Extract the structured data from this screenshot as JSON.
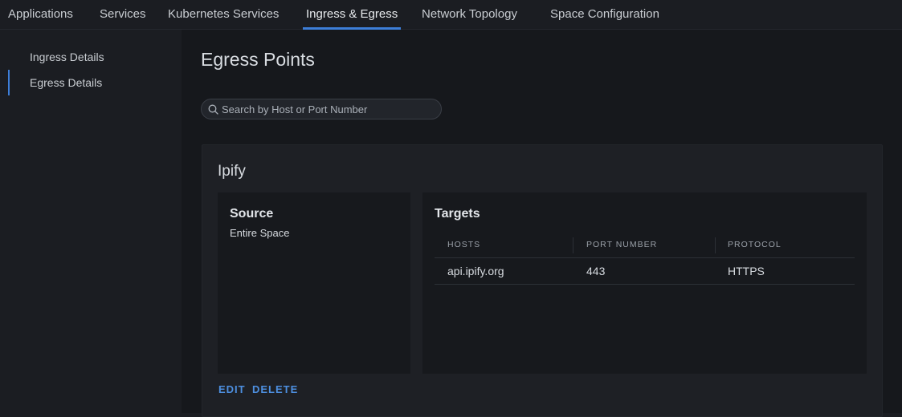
{
  "topnav": {
    "tabs": [
      {
        "label": "Applications"
      },
      {
        "label": "Services"
      },
      {
        "label": "Kubernetes Services"
      },
      {
        "label": "Ingress & Egress",
        "active": true
      },
      {
        "label": "Network Topology"
      },
      {
        "label": "Space Configuration"
      }
    ]
  },
  "sidebar": {
    "items": [
      {
        "label": "Ingress Details"
      },
      {
        "label": "Egress Details",
        "active": true
      }
    ]
  },
  "main": {
    "title": "Egress Points",
    "search": {
      "placeholder": "Search by Host or Port Number",
      "value": ""
    },
    "egress": {
      "name": "Ipify",
      "source": {
        "heading": "Source",
        "value": "Entire Space"
      },
      "targets": {
        "heading": "Targets",
        "columns": [
          "HOSTS",
          "PORT NUMBER",
          "PROTOCOL"
        ],
        "rows": [
          [
            "api.ipify.org",
            "443",
            "HTTPS"
          ]
        ]
      },
      "actions": {
        "edit": "EDIT",
        "delete": "DELETE"
      }
    }
  },
  "colors": {
    "accent": "#3d7ed8",
    "link": "#4d8fe0",
    "background": "#16181c",
    "card": "#1e2025"
  }
}
